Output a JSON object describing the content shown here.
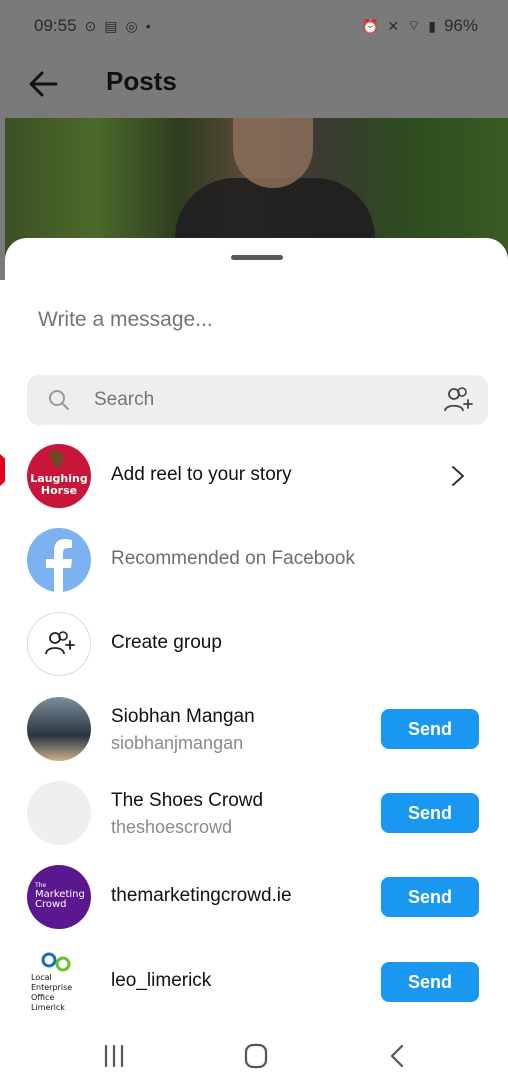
{
  "status_bar": {
    "time": "09:55",
    "left_icons": [
      "alarm-clock-icon",
      "radio-icon",
      "instagram-icon",
      "dot-icon"
    ],
    "right_icons": [
      "alarm-icon",
      "mute-icon",
      "wifi-icon",
      "signal-icon"
    ],
    "battery": "96%"
  },
  "app_bar": {
    "back_icon": "back-arrow-icon",
    "title": "Posts"
  },
  "share_sheet": {
    "message_placeholder": "Write a message...",
    "search": {
      "placeholder": "Search",
      "icon": "search-icon",
      "action_icon": "add-people-icon"
    },
    "story_row": {
      "label": "Add reel to your story",
      "avatar_text": "The Laughing Horse",
      "avatar_color": "#c8163a"
    },
    "facebook_row": {
      "label": "Recommended on Facebook",
      "icon_color": "#7cb2ef"
    },
    "group_row": {
      "label": "Create group"
    },
    "contacts": [
      {
        "name": "Siobhan Mangan",
        "username": "siobhanjmangan",
        "action": "Send"
      },
      {
        "name": "The Shoes Crowd",
        "username": "theshoescrowd",
        "action": "Send"
      },
      {
        "name": "themarketingcrowd.ie",
        "username": "",
        "action": "Send",
        "avatar_text": "The Marketing Crowd",
        "avatar_color": "#5b1790"
      },
      {
        "name": "leo_limerick",
        "username": "",
        "action": "Send",
        "avatar_text": "Local Enterprise Office Limerick"
      }
    ]
  },
  "nav_bar": {
    "items": [
      "recents-icon",
      "home-icon",
      "back-icon"
    ]
  },
  "colors": {
    "send_button": "#1a97f0",
    "accent_red": "#e8001c"
  }
}
